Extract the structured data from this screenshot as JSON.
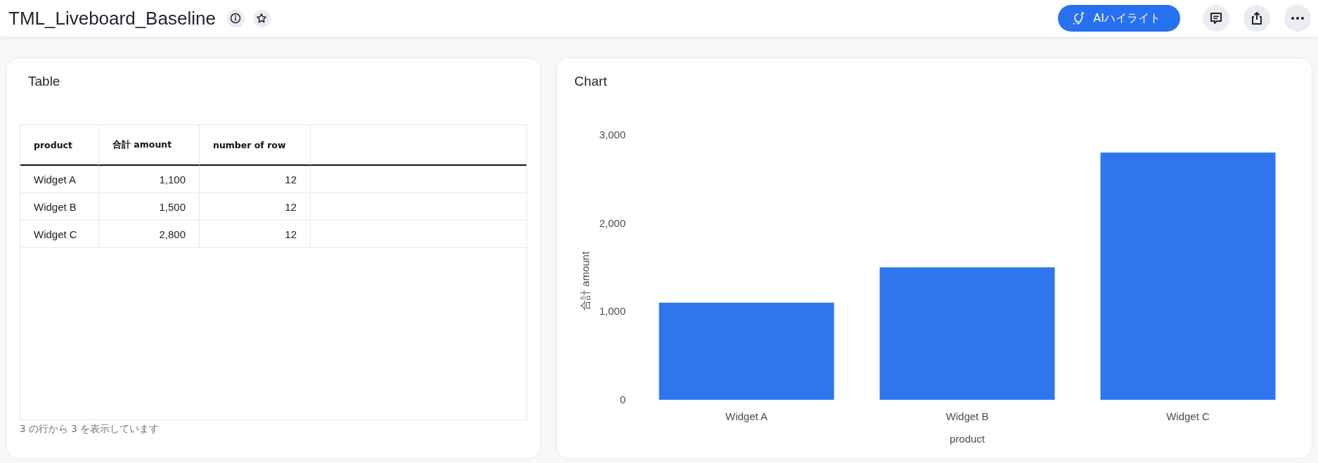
{
  "header": {
    "title": "TML_Liveboard_Baseline",
    "ai_button": "AIハイライト"
  },
  "table_card": {
    "title": "Table",
    "columns": [
      "product",
      "合計 amount",
      "number of row"
    ],
    "rows": [
      [
        "Widget A",
        "1,100",
        "12"
      ],
      [
        "Widget B",
        "1,500",
        "12"
      ],
      [
        "Widget C",
        "2,800",
        "12"
      ]
    ],
    "footer": "3 の行から 3 を表示しています"
  },
  "chart_card": {
    "title": "Chart",
    "chart_data": {
      "type": "bar",
      "xlabel": "product",
      "ylabel": "合計 amount",
      "categories": [
        "Widget A",
        "Widget B",
        "Widget C"
      ],
      "series": [
        {
          "color": "#2f76ee",
          "values": [
            1100,
            1500,
            2800
          ]
        }
      ],
      "ylim": [
        0,
        3000
      ],
      "yticks": [
        {
          "value": 0,
          "label": "0"
        },
        {
          "value": 1000,
          "label": "1,000"
        },
        {
          "value": 2000,
          "label": "2,000"
        },
        {
          "value": 3000,
          "label": "3,000"
        }
      ]
    }
  }
}
